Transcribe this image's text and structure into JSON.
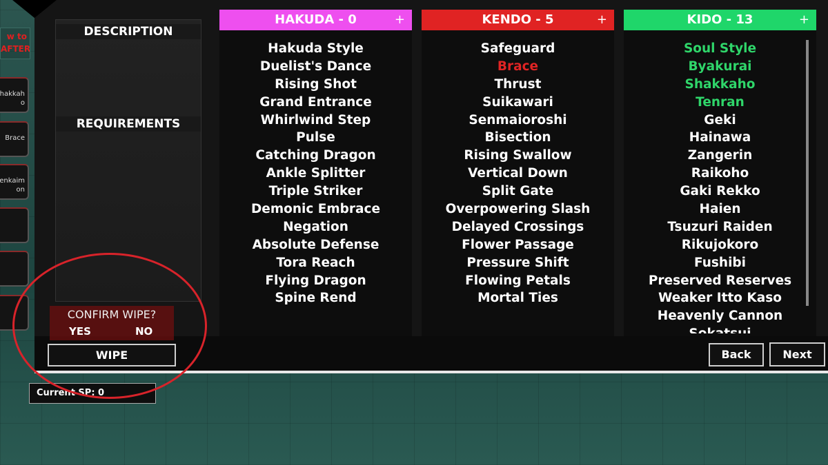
{
  "sidebar": {
    "info_text": [
      "w to",
      "AFTER"
    ],
    "slots": [
      "hakkah o",
      "Brace",
      "enkaim on",
      "",
      "",
      ""
    ]
  },
  "description": {
    "title": "DESCRIPTION",
    "requirements_title": "REQUIREMENTS"
  },
  "confirm": {
    "question": "CONFIRM WIPE?",
    "yes": "YES",
    "no": "NO"
  },
  "wipe_label": "WIPE",
  "current_sp": "Current SP: 0",
  "nav": {
    "back": "Back",
    "next": "Next"
  },
  "columns": [
    {
      "title": "HAKUDA - 0",
      "color": "#ee4fef",
      "plus": "+",
      "items": [
        {
          "label": "Hakuda Style"
        },
        {
          "label": "Duelist's Dance"
        },
        {
          "label": "Rising Shot"
        },
        {
          "label": "Grand Entrance"
        },
        {
          "label": "Whirlwind Step"
        },
        {
          "label": "Pulse"
        },
        {
          "label": "Catching Dragon"
        },
        {
          "label": "Ankle Splitter"
        },
        {
          "label": "Triple Striker"
        },
        {
          "label": "Demonic Embrace"
        },
        {
          "label": "Negation"
        },
        {
          "label": "Absolute Defense"
        },
        {
          "label": "Tora Reach"
        },
        {
          "label": "Flying Dragon"
        },
        {
          "label": "Spine Rend"
        }
      ]
    },
    {
      "title": "KENDO - 5",
      "color": "#e02323",
      "plus": "+",
      "items": [
        {
          "label": "Safeguard"
        },
        {
          "label": "Brace",
          "state": "red"
        },
        {
          "label": "Thrust"
        },
        {
          "label": "Suikawari"
        },
        {
          "label": "Senmaioroshi"
        },
        {
          "label": "Bisection"
        },
        {
          "label": "Rising Swallow"
        },
        {
          "label": "Vertical Down"
        },
        {
          "label": "Split Gate"
        },
        {
          "label": "Overpowering Slash"
        },
        {
          "label": "Delayed Crossings"
        },
        {
          "label": "Flower Passage"
        },
        {
          "label": "Pressure Shift"
        },
        {
          "label": "Flowing Petals"
        },
        {
          "label": "Mortal Ties"
        }
      ]
    },
    {
      "title": "KIDO - 13",
      "color": "#1fd66a",
      "plus": "+",
      "items": [
        {
          "label": "Soul Style",
          "state": "green"
        },
        {
          "label": "Byakurai",
          "state": "green"
        },
        {
          "label": "Shakkaho",
          "state": "green"
        },
        {
          "label": "Tenran",
          "state": "green"
        },
        {
          "label": "Geki"
        },
        {
          "label": "Hainawa"
        },
        {
          "label": "Zangerin"
        },
        {
          "label": "Raikoho"
        },
        {
          "label": "Gaki Rekko"
        },
        {
          "label": "Haien"
        },
        {
          "label": "Tsuzuri Raiden"
        },
        {
          "label": "Rikujokoro"
        },
        {
          "label": "Fushibi"
        },
        {
          "label": "Preserved Reserves"
        },
        {
          "label": "Weaker Itto Kaso"
        },
        {
          "label": "Heavenly Cannon"
        },
        {
          "label": "Sokatsui"
        }
      ]
    }
  ]
}
